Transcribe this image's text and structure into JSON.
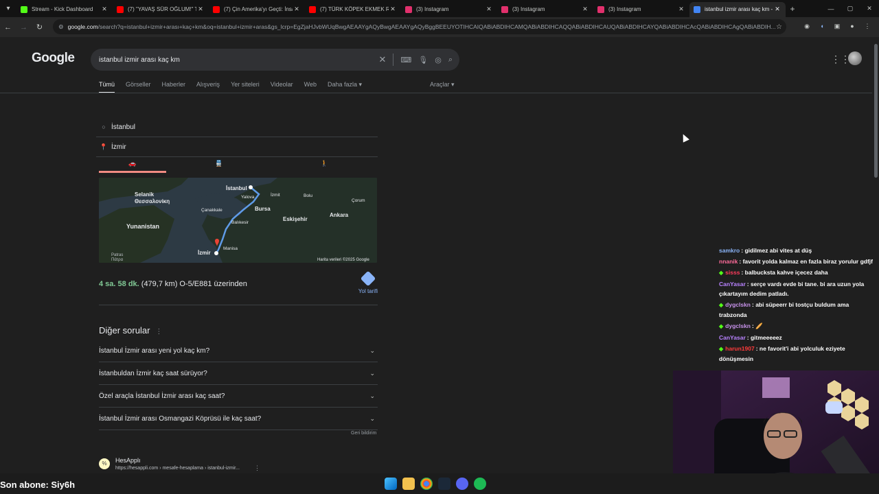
{
  "browser": {
    "tabs": [
      {
        "title": "Stream - Kick Dashboard",
        "favicon_color": "#53fc18",
        "active": false
      },
      {
        "title": "(7) \"YAVAŞ SÜR OĞLUM!\" Tr",
        "favicon_color": "#ff0000",
        "active": false
      },
      {
        "title": "(7) Çin Amerika'yı Geçti: İnsa",
        "favicon_color": "#ff0000",
        "active": false
      },
      {
        "title": "(7) TÜRK KÖPEK EKMEK REF",
        "favicon_color": "#ff0000",
        "active": false
      },
      {
        "title": "(3) Instagram",
        "favicon_color": "#e1306c",
        "active": false
      },
      {
        "title": "(3) Instagram",
        "favicon_color": "#e1306c",
        "active": false
      },
      {
        "title": "(3) Instagram",
        "favicon_color": "#e1306c",
        "active": false
      },
      {
        "title": "istanbul izmir arası kaç km -",
        "favicon_color": "#4285f4",
        "active": true
      }
    ],
    "url_domain": "google.com",
    "url_rest": "/search?q=istanbul+izmir+arası+kaç+km&oq=istanbul+izmir+aras&gs_lcrp=EgZjaHJvbWUqBwgAEAAYgAQyBwgAEAAYgAQyBggBEEUYOTIHCAIQABiABDIHCAMQABiABDIHCAQQABiABDIHCAUQABiABDIHCAYQABiABDIHCAcQABiABDIHCAgQABiABDIH..."
  },
  "google": {
    "logo": "Google",
    "query": "istanbul izmir arası kaç km",
    "filters": [
      "Tümü",
      "Görseller",
      "Haberler",
      "Alışveriş",
      "Yer siteleri",
      "Videolar",
      "Web",
      "Daha fazla ▾"
    ],
    "tools": "Araçlar ▾",
    "origin": "İstanbul",
    "destination": "İzmir",
    "map_labels": {
      "istanbul": "İstanbul",
      "selanik": "Selanik\nΘεσσαλονίκη",
      "yalova": "Yalova",
      "izmit": "İzmit",
      "bolu": "Bolu",
      "corum": "Çorum",
      "canakkale": "Çanakkale",
      "bursa": "Bursa",
      "yunanistan": "Yunanistan",
      "balikesir": "Balıkesir",
      "eskisehir": "Eskişehir",
      "ankara": "Ankara",
      "manisa": "Manisa",
      "izmir": "İzmir",
      "patras": "Patras\nΠάτρα",
      "credit": "Harita verileri ©2025 Google"
    },
    "duration": "4 sa. 58 dk.",
    "distance": "(479,7 km) O-5/E881 üzerinden",
    "directions_label": "Yol tarifi",
    "paa_title": "Diğer sorular",
    "paa": [
      "İstanbul İzmir arası yeni yol kaç km?",
      "İstanbuldan İzmir kaç saat sürüyor?",
      "Özel araçla İstanbul İzmir arası kaç saat?",
      "İstanbul İzmir arası Osmangazi Köprüsü ile kaç saat?"
    ],
    "feedback": "Geri bildirim",
    "result": {
      "site": "HesApplı",
      "url": "https://hesappli.com › mesafe-hesaplama › istanbul-izmir..."
    }
  },
  "chat": [
    {
      "user": "samkro",
      "user_color": "#8ab4f8",
      "text": ": gidilmez abi vites at düş",
      "badge": false
    },
    {
      "user": "nnanik",
      "user_color": "#ff6b9a",
      "text": ": favorit yolda kalmaz en fazla biraz yorulur gdfjf",
      "badge": false
    },
    {
      "user": "sisss",
      "user_color": "#ff3b5c",
      "text": ": balbucksta kahve içecez daha",
      "badge": true
    },
    {
      "user": "CanYasar",
      "user_color": "#b983ff",
      "text": ": serçe vardı evde bi tane. bi ara uzun yola çıkartayım dedim patladı.",
      "badge": false
    },
    {
      "user": "dygclskn",
      "user_color": "#c792ea",
      "text": ": abi süpeerr bi tostçu buldum ama trabzonda",
      "badge": true
    },
    {
      "user": "dygclskn",
      "user_color": "#c792ea",
      "text": ": 🥖",
      "badge": true
    },
    {
      "user": "CanYasar",
      "user_color": "#b983ff",
      "text": ": gitmeeeeez",
      "badge": false
    },
    {
      "user": "harun1907",
      "user_color": "#ff3b3b",
      "text": ": ne favorit'i abi yolculuk eziyete dönüşmesin",
      "badge": true
    }
  ],
  "overlay": {
    "last_sub": "Son abone: Siy6h"
  }
}
